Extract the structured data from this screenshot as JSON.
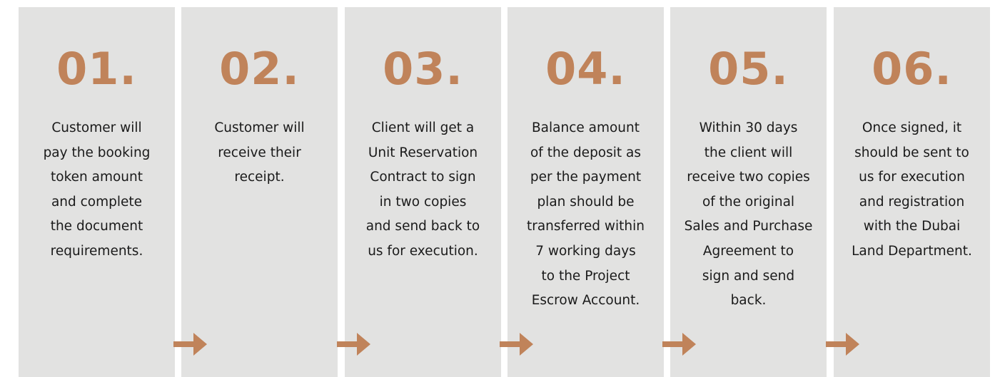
{
  "accent_color": "#c0835a",
  "card_color": "#e2e2e1",
  "steps": [
    {
      "number": "01.",
      "text": "Customer will\npay the booking\ntoken amount\nand complete\nthe document\nrequirements."
    },
    {
      "number": "02.",
      "text": "Customer will\nreceive their\nreceipt."
    },
    {
      "number": "03.",
      "text": "Client will get a\nUnit Reservation\nContract to sign\nin two copies\nand send back to\nus for execution."
    },
    {
      "number": "04.",
      "text": "Balance amount\nof the deposit as\nper the payment\nplan should be\ntransferred within\n7 working days\nto the Project\nEscrow Account."
    },
    {
      "number": "05.",
      "text": "Within 30 days\nthe client will\nreceive two copies\nof the original\nSales and Purchase\nAgreement to\nsign and send\nback."
    },
    {
      "number": "06.",
      "text": "Once signed, it\nshould be sent to\nus for execution\nand registration\nwith the Dubai\nLand Department."
    }
  ],
  "arrows": [
    {
      "icon": "arrow-right-icon"
    },
    {
      "icon": "arrow-right-icon"
    },
    {
      "icon": "arrow-right-icon"
    },
    {
      "icon": "arrow-right-icon"
    },
    {
      "icon": "arrow-right-icon"
    }
  ]
}
